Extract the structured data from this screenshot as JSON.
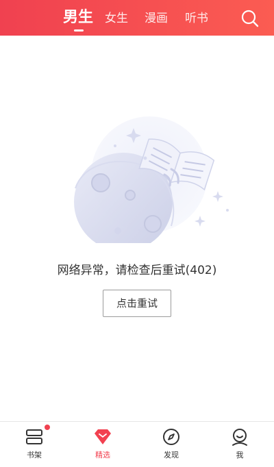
{
  "header": {
    "tabs": [
      {
        "label": "男生",
        "active": true
      },
      {
        "label": "女生",
        "active": false
      },
      {
        "label": "漫画",
        "active": false
      },
      {
        "label": "听书",
        "active": false
      }
    ],
    "search_icon": "search-icon",
    "background_colors": [
      "#f04150",
      "#fb5c52"
    ]
  },
  "main": {
    "error_message": "网络异常，请检查后重试(402)",
    "retry_label": "点击重试",
    "illustration_icon": "moon-book-illustration"
  },
  "bottom_nav": {
    "items": [
      {
        "label": "书架",
        "icon": "bookshelf-icon",
        "active": false,
        "badge": true
      },
      {
        "label": "精选",
        "icon": "gem-icon",
        "active": true,
        "badge": false
      },
      {
        "label": "发现",
        "icon": "compass-icon",
        "active": false,
        "badge": false
      },
      {
        "label": "我",
        "icon": "profile-icon",
        "active": false,
        "badge": false
      }
    ],
    "active_color": "#f24150"
  }
}
